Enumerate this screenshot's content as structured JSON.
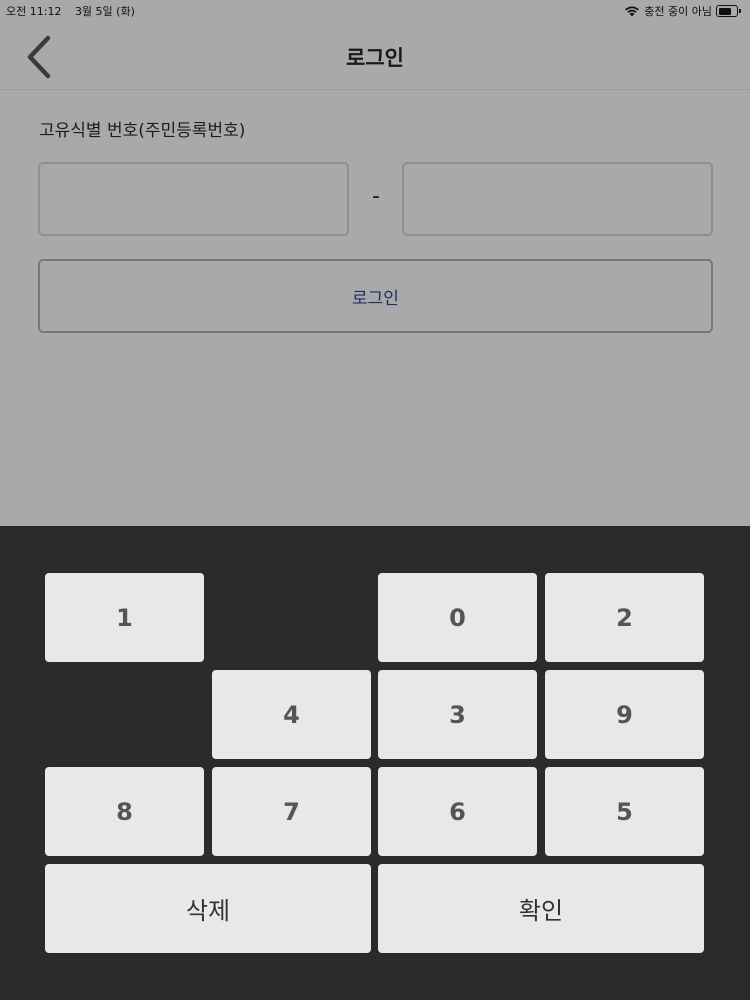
{
  "status_bar": {
    "time": "오전 11:12",
    "date": "3월 5일 (화)",
    "charging": "충전 중이 아님"
  },
  "nav": {
    "title": "로그인"
  },
  "form": {
    "label": "고유식별 번호(주민등록번호)",
    "front_value": "",
    "back_value": "",
    "separator": "-",
    "login_label": "로그인"
  },
  "keypad": {
    "keys": [
      "1",
      "0",
      "2",
      "4",
      "3",
      "9",
      "8",
      "7",
      "6",
      "5"
    ],
    "delete_label": "삭제",
    "confirm_label": "확인"
  },
  "colors": {
    "overlay_bg": "#a9a8aa",
    "keypad_bg": "#2b2a2c",
    "key_bg": "#e8e7ea",
    "login_text": "#1c2f5e"
  }
}
